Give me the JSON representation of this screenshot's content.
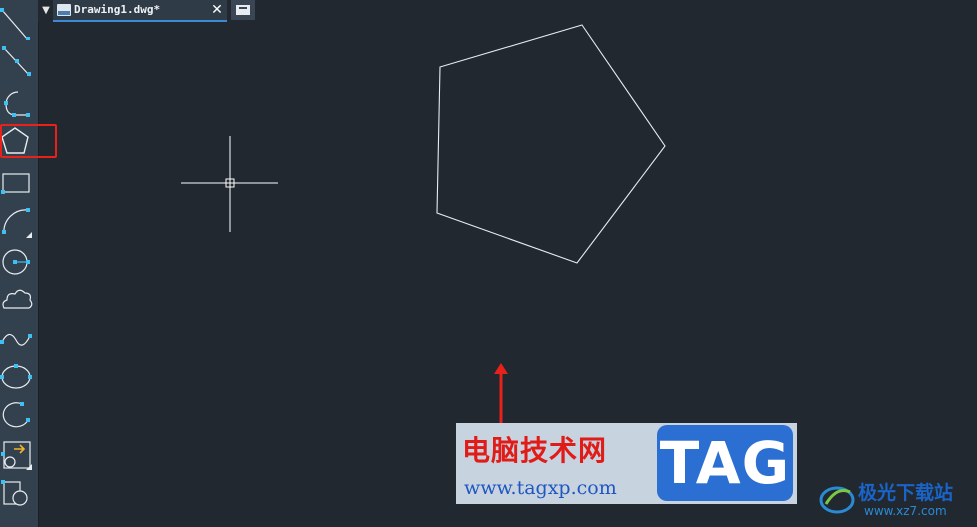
{
  "tabbar": {
    "tab_label": "Drawing1.dwg*",
    "close_glyph": "✕",
    "menu_glyph": "▼"
  },
  "toolbar": {
    "tools": [
      {
        "name": "line-tool",
        "icon": "line-icon"
      },
      {
        "name": "ray-tool",
        "icon": "ray-icon"
      },
      {
        "name": "polyline-tool",
        "icon": "polyline-icon"
      },
      {
        "name": "polygon-tool",
        "icon": "pentagon-icon",
        "highlighted": true
      },
      {
        "name": "rectangle-tool",
        "icon": "rectangle-icon"
      },
      {
        "name": "arc-tool",
        "icon": "arc-icon"
      },
      {
        "name": "circle-tool",
        "icon": "circle-icon"
      },
      {
        "name": "revision-cloud-tool",
        "icon": "cloud-icon"
      },
      {
        "name": "spline-tool",
        "icon": "spline-icon"
      },
      {
        "name": "ellipse-tool",
        "icon": "ellipse-icon"
      },
      {
        "name": "ellipse-arc-tool",
        "icon": "ellipse-arc-icon"
      },
      {
        "name": "insert-block-tool",
        "icon": "insert-block-icon"
      },
      {
        "name": "make-block-tool",
        "icon": "make-block-icon"
      }
    ]
  },
  "watermark": {
    "site_cn": "电脑技术网",
    "site_url": "www.tagxp.com",
    "badge": "TAG"
  },
  "brand": {
    "name_cn": "极光下载站",
    "url": "www.xz7.com"
  },
  "colors": {
    "canvas": "#212830",
    "toolbar": "#33404d",
    "icon_accent": "#3ec1f2",
    "highlight": "#e8211b",
    "arrow": "#e8211b"
  }
}
